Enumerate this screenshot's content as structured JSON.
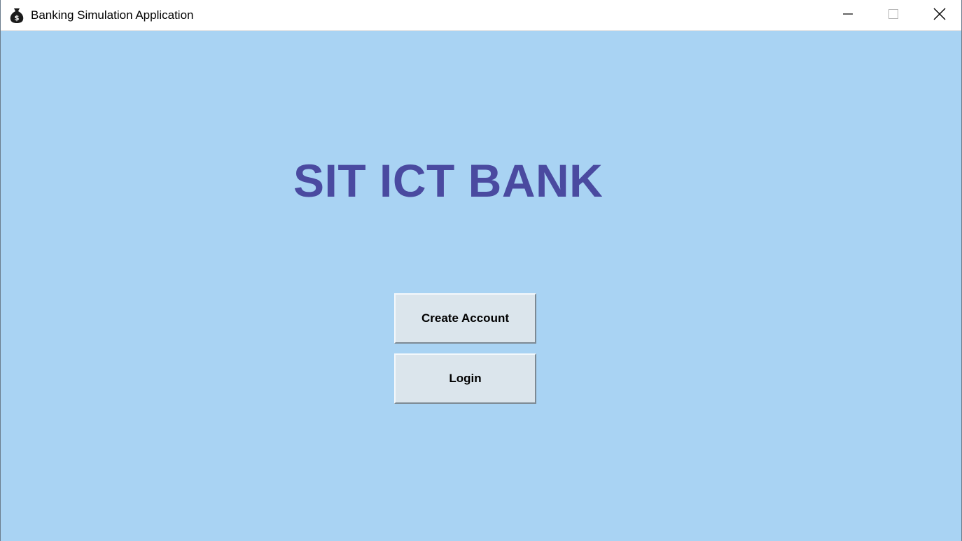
{
  "window": {
    "title": "Banking Simulation Application",
    "app_icon": "money-bag-icon",
    "controls": {
      "minimize_icon": "minimize-icon",
      "maximize_icon": "maximize-icon",
      "close_icon": "close-icon"
    }
  },
  "main": {
    "heading": "SIT ICT BANK",
    "buttons": {
      "create_account": "Create Account",
      "login": "Login"
    }
  },
  "colors": {
    "background": "#a9d3f3",
    "heading": "#4a4aa0",
    "button_face": "#dbe5ec",
    "titlebar": "#ffffff"
  }
}
